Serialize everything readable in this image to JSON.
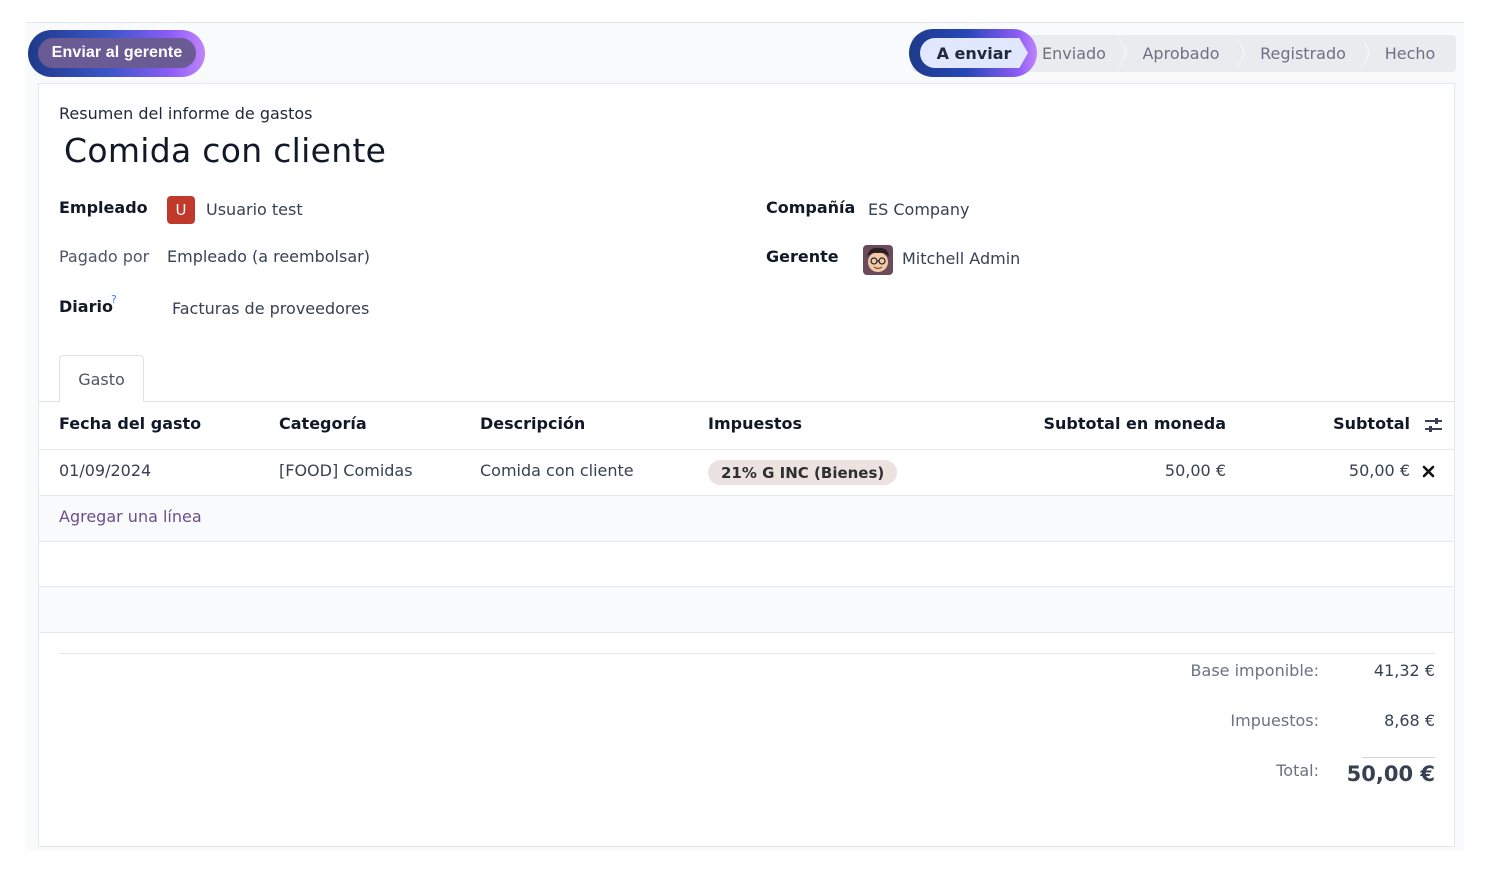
{
  "control_panel": {
    "submit_button": "Enviar al gerente",
    "stages": [
      "A enviar",
      "Enviado",
      "Aprobado",
      "Registrado",
      "Hecho"
    ],
    "active_stage": "A enviar"
  },
  "form": {
    "subtitle": "Resumen del informe de gastos",
    "title": "Comida con cliente",
    "fields": {
      "employee_label": "Empleado",
      "employee_initial": "U",
      "employee_value": "Usuario test",
      "paid_by_label": "Pagado por",
      "paid_by_value": "Empleado (a reembolsar)",
      "journal_label": "Diario",
      "journal_help": "?",
      "journal_value": "Facturas de proveedores",
      "company_label": "Compañía",
      "company_value": "ES Company",
      "manager_label": "Gerente",
      "manager_value": "Mitchell Admin"
    }
  },
  "tabs": [
    {
      "label": "Gasto"
    }
  ],
  "table": {
    "columns": [
      "Fecha del gasto",
      "Categoría",
      "Descripción",
      "Impuestos",
      "Subtotal en moneda",
      "Subtotal"
    ],
    "rows": [
      {
        "date": "01/09/2024",
        "category": "[FOOD] Comidas",
        "description": "Comida con cliente",
        "tax": "21% G INC (Bienes)",
        "subtotal_currency": "50,00 €",
        "subtotal": "50,00 €"
      }
    ],
    "add_line": "Agregar una línea"
  },
  "totals": {
    "base_label": "Base imponible:",
    "base_value": "41,32 €",
    "tax_label": "Impuestos:",
    "tax_value": "8,68 €",
    "total_label": "Total:",
    "total_value": "50,00 €"
  },
  "colors": {
    "primary": "#6b5b95",
    "danger_avatar": "#c0392b",
    "link": "#6b4e8f"
  }
}
